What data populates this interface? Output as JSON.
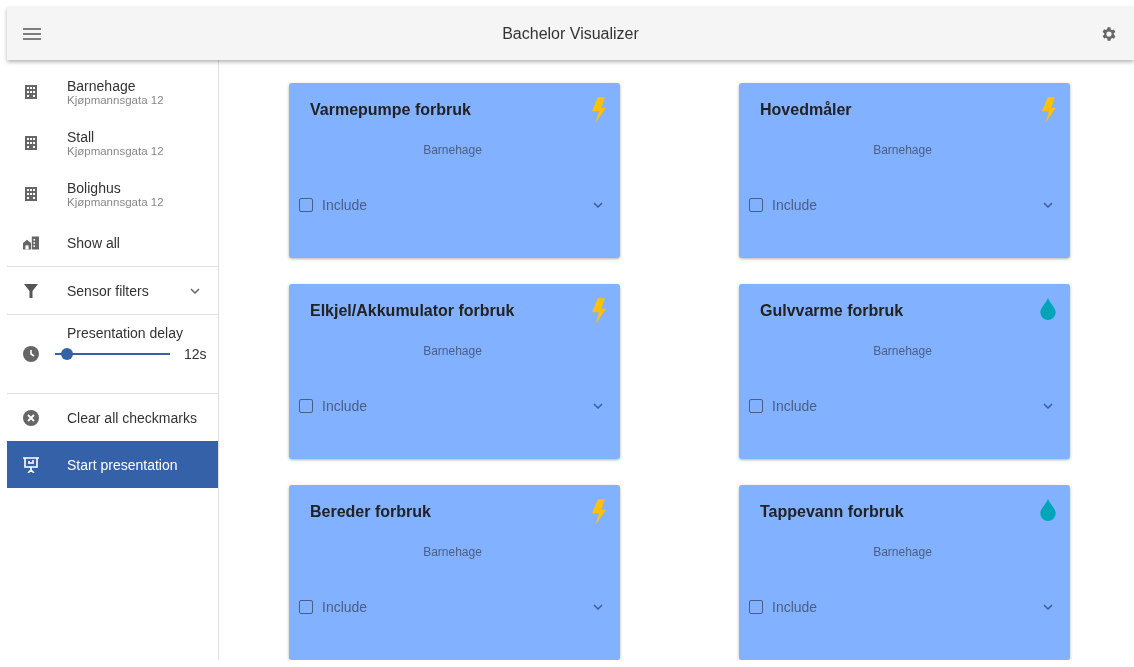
{
  "app_bar": {
    "title": "Bachelor Visualizer"
  },
  "sidebar": {
    "locations": [
      {
        "name": "Barnehage",
        "address": "Kjøpmannsgata 12"
      },
      {
        "name": "Stall",
        "address": "Kjøpmannsgata 12"
      },
      {
        "name": "Bolighus",
        "address": "Kjøpmannsgata 12"
      }
    ],
    "show_all": "Show all",
    "sensor_filters": {
      "label": "Sensor filters",
      "expanded": false
    },
    "presentation_delay": {
      "label": "Presentation delay",
      "level": 0.1,
      "reading": "12s"
    },
    "actions": [
      {
        "label": "Clear all checkmarks",
        "kind": "clear",
        "selected": false
      },
      {
        "label": "Start presentation",
        "kind": "present",
        "selected": true
      }
    ]
  },
  "cards": [
    {
      "title": "Varmepumpe forbruk",
      "kind": "energy",
      "location": "Barnehage",
      "include": "Include",
      "checked": false
    },
    {
      "title": "Hovedmåler",
      "kind": "energy",
      "location": "Barnehage",
      "include": "Include",
      "checked": false
    },
    {
      "title": "Elkjel/Akkumulator forbruk",
      "kind": "energy",
      "location": "Barnehage",
      "include": "Include",
      "checked": false
    },
    {
      "title": "Gulvvarme forbruk",
      "kind": "water",
      "location": "Barnehage",
      "include": "Include",
      "checked": false
    },
    {
      "title": "Bereder forbruk",
      "kind": "energy",
      "location": "Barnehage",
      "include": "Include",
      "checked": false
    },
    {
      "title": "Tappevann forbruk",
      "kind": "water",
      "location": "Barnehage",
      "include": "Include",
      "checked": false
    }
  ]
}
